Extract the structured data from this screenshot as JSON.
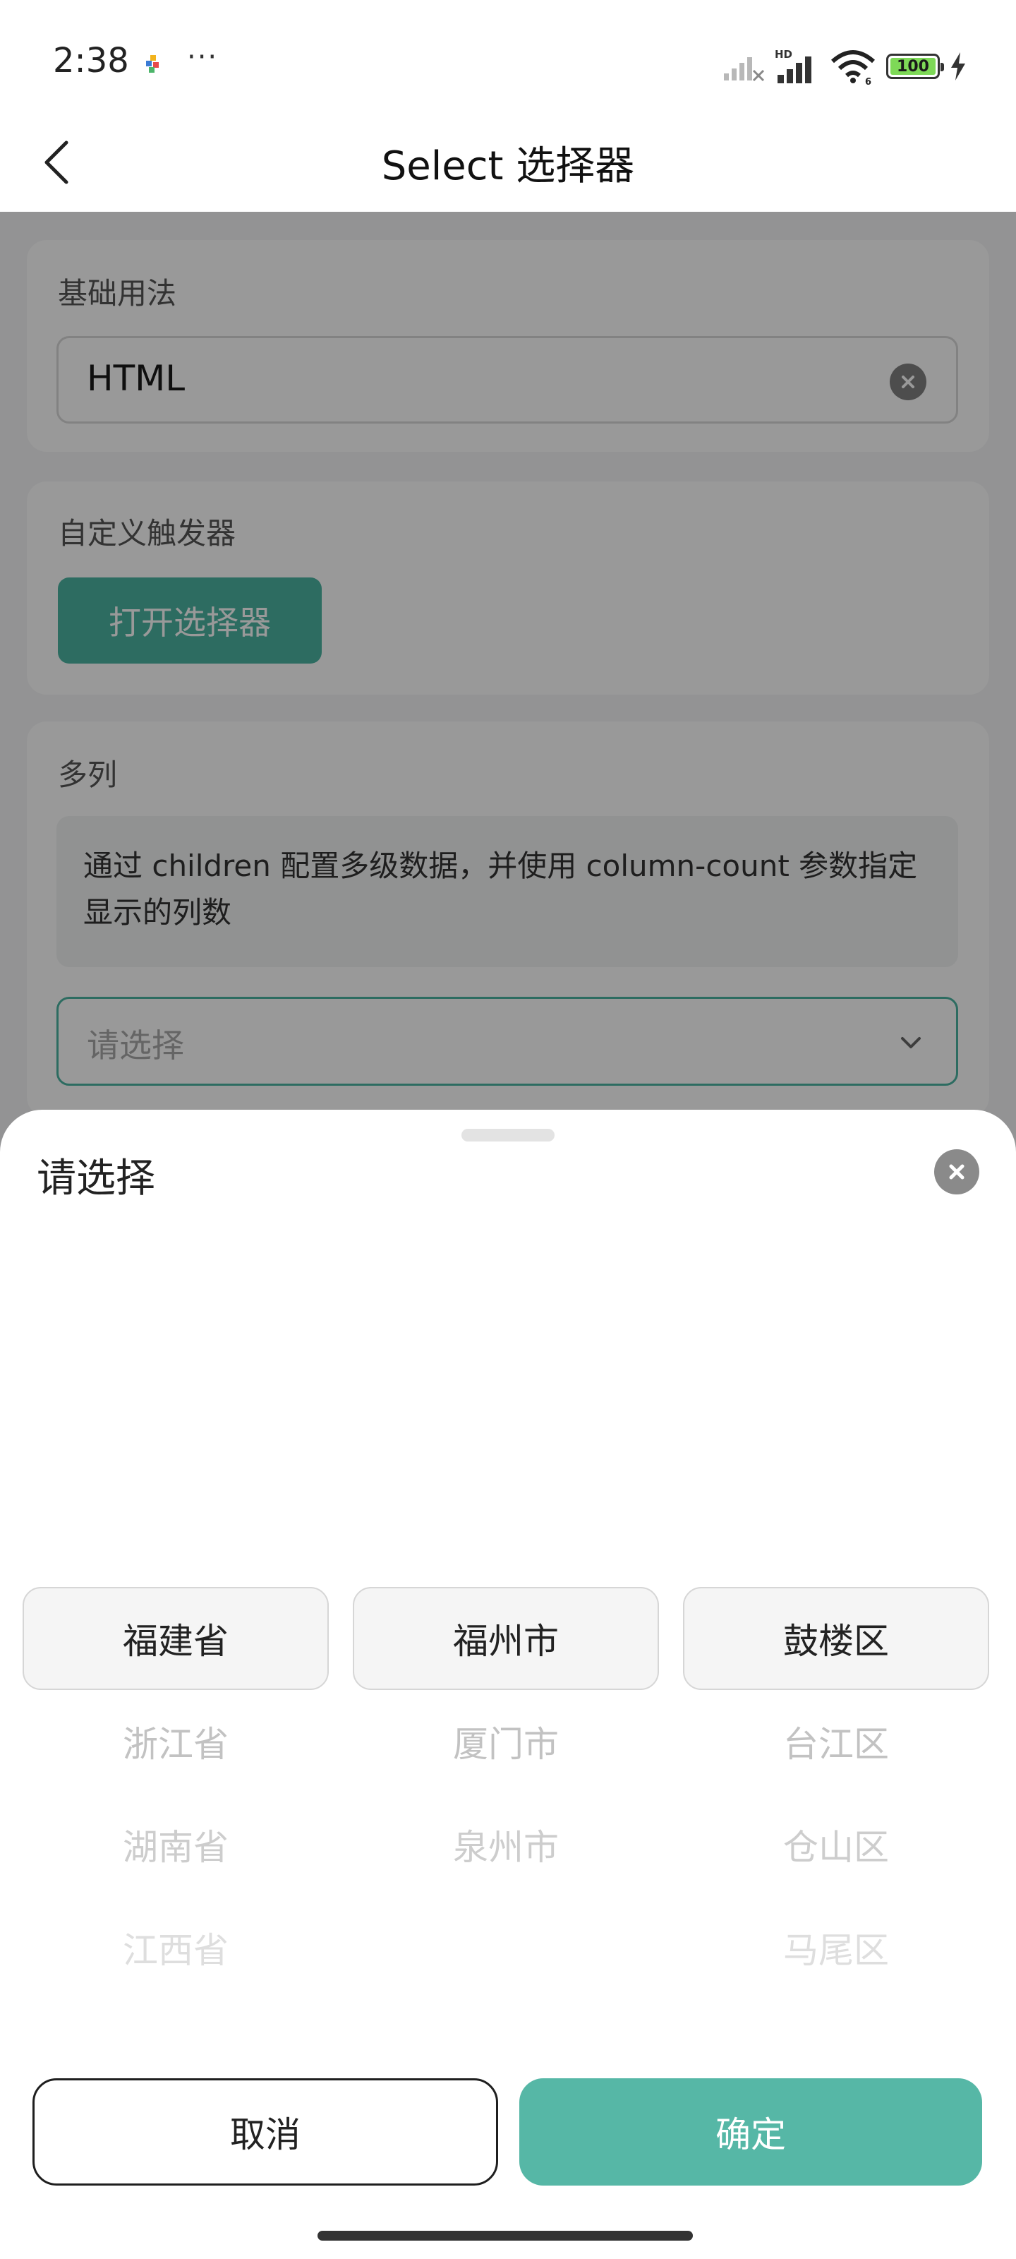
{
  "status_bar": {
    "time": "2:38",
    "more": "···",
    "network_badge": "HD",
    "wifi_badge": "6",
    "battery": "100",
    "battery_color": "#7ed957"
  },
  "header": {
    "title": "Select 选择器",
    "back_icon": "chevron-left-icon"
  },
  "sections": {
    "basic": {
      "label": "基础用法",
      "value": "HTML",
      "clear_icon": "clear-icon"
    },
    "custom_trigger": {
      "label": "自定义触发器",
      "button_label": "打开选择器"
    },
    "multi_column": {
      "label": "多列",
      "notice": "通过 children 配置多级数据，并使用 column-count 参数指定显示的列数",
      "placeholder": "请选择",
      "dropdown_icon": "chevron-down-icon"
    }
  },
  "sheet": {
    "title": "请选择",
    "close_icon": "close-icon",
    "columns": [
      [
        "福建省",
        "浙江省",
        "湖南省",
        "江西省"
      ],
      [
        "福州市",
        "厦门市",
        "泉州市"
      ],
      [
        "鼓楼区",
        "台江区",
        "仓山区",
        "马尾区"
      ]
    ],
    "cancel_label": "取消",
    "confirm_label": "确定"
  },
  "colors": {
    "primary": "#4cb5a2",
    "confirm": "#56b7a6",
    "overlay": "rgba(0,0,0,0.40)"
  }
}
